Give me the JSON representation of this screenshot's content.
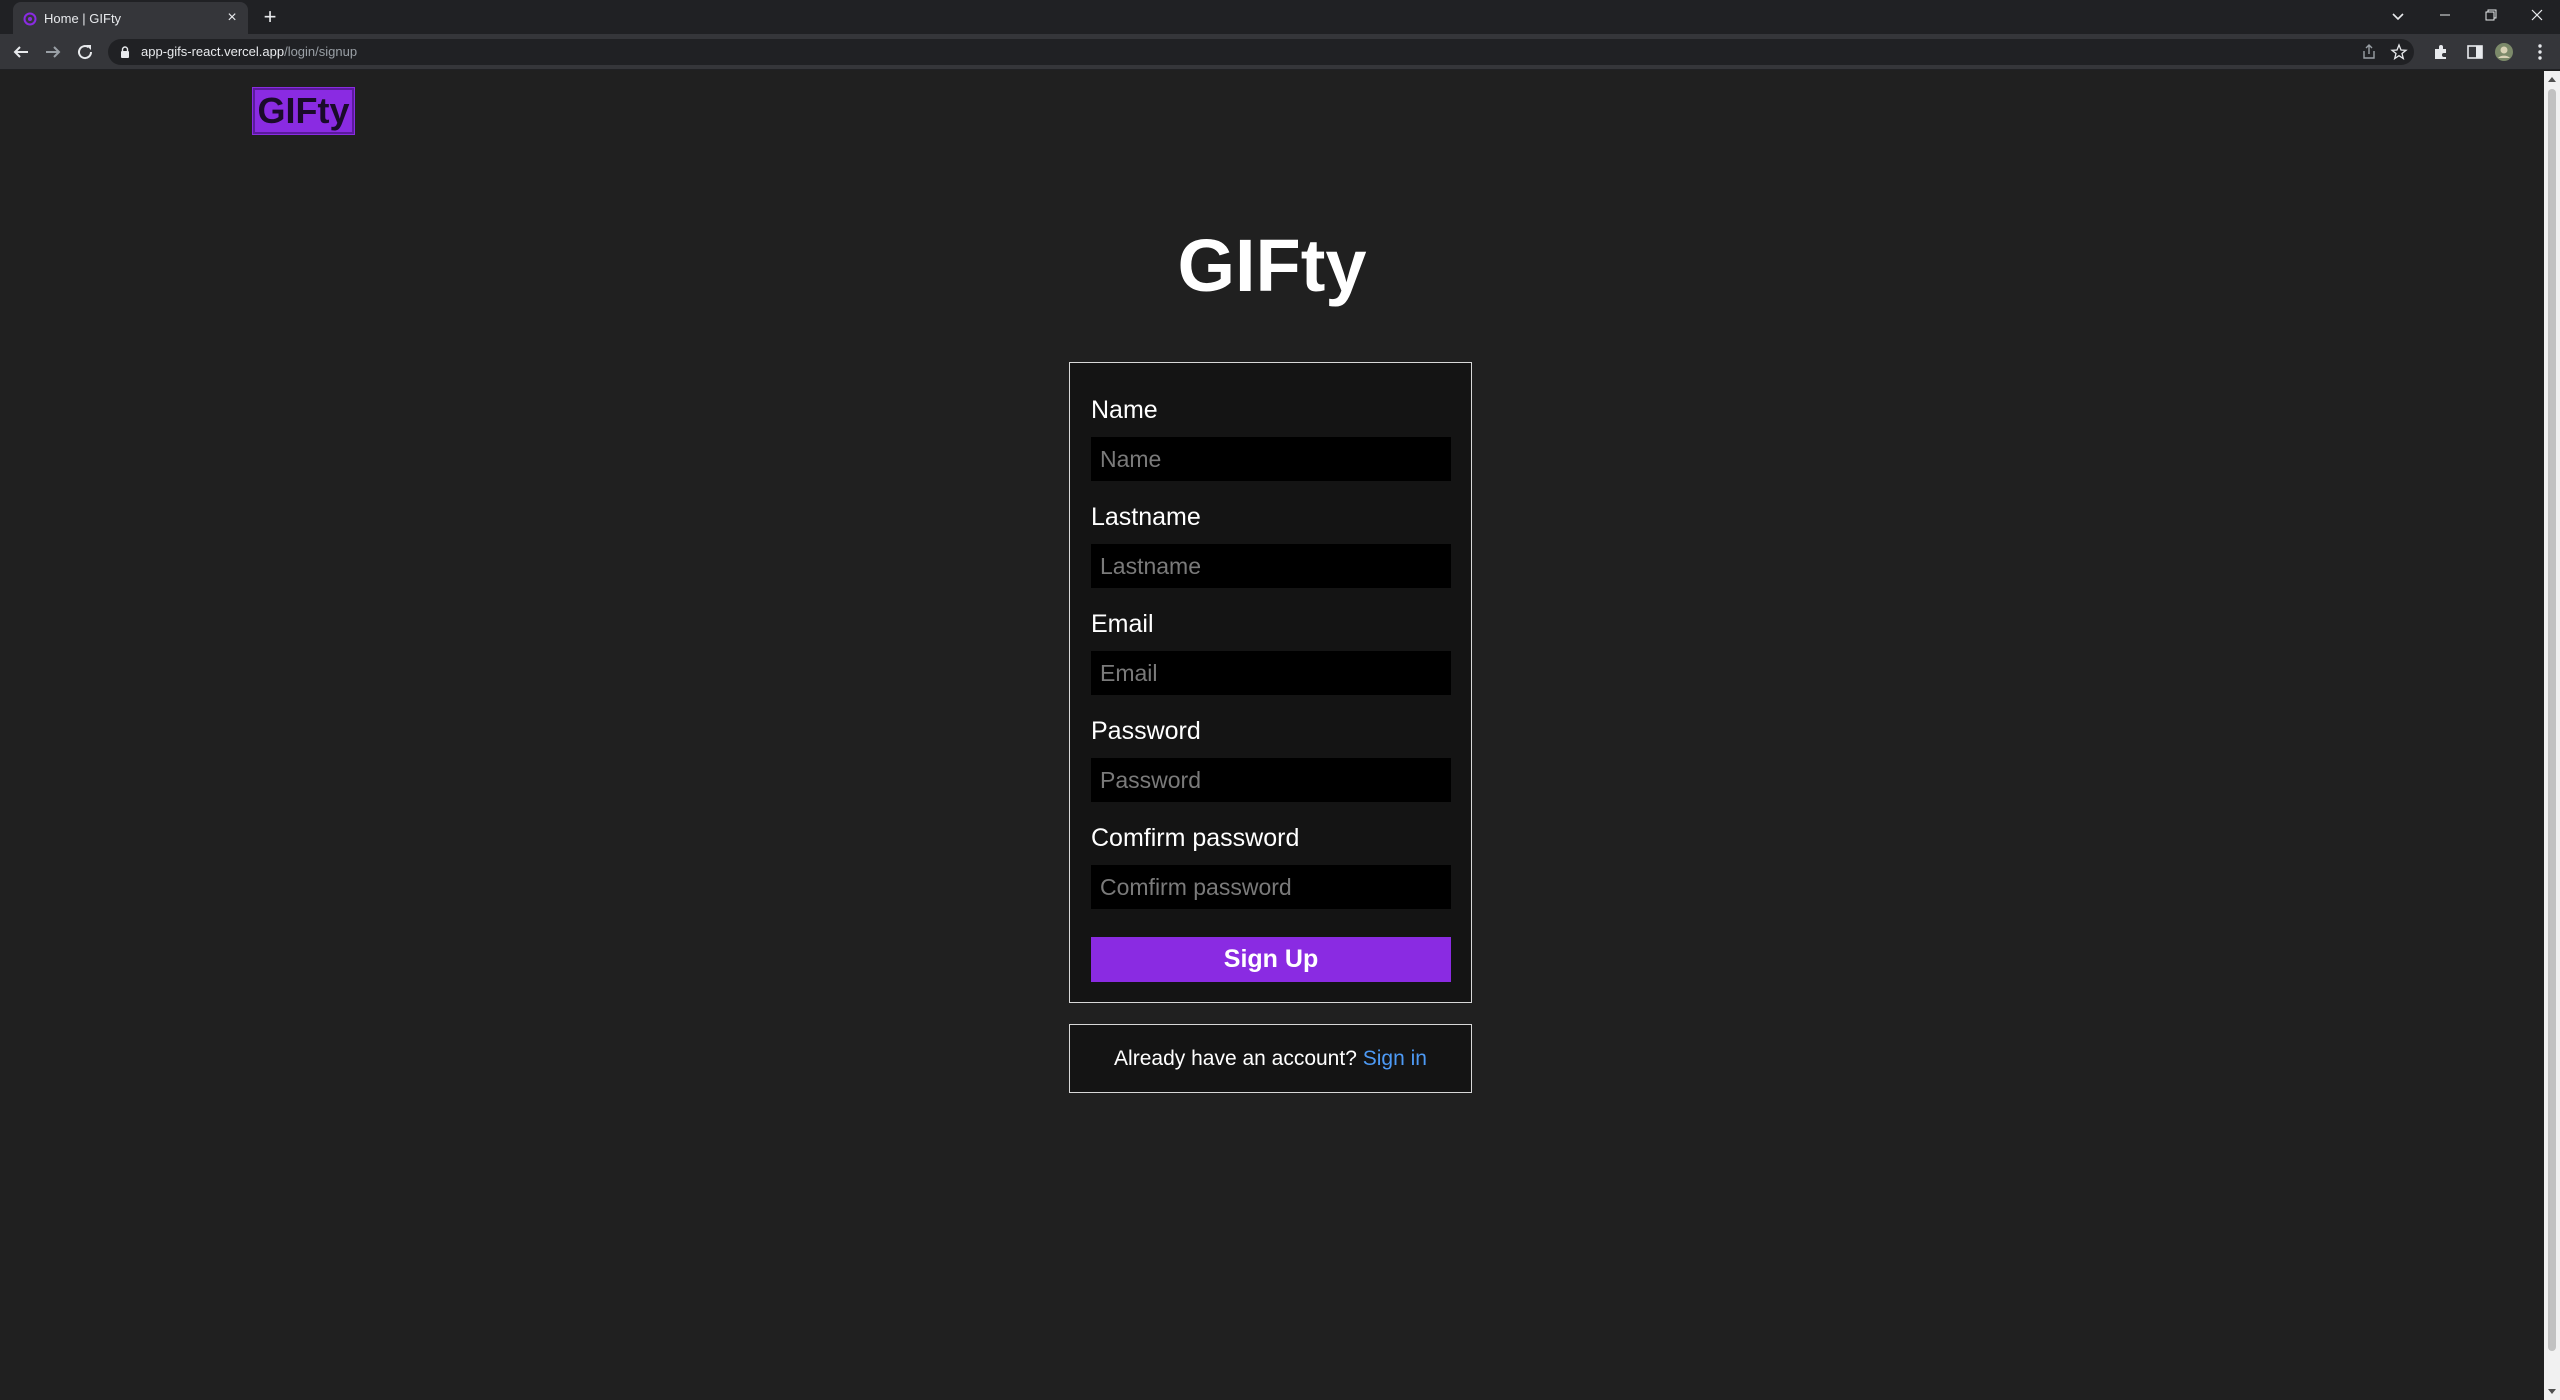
{
  "browser": {
    "tab_title": "Home | GIFty",
    "new_tab_symbol": "+",
    "url_host": "app-gifs-react.vercel.app",
    "url_path": "/login/signup"
  },
  "header": {
    "logo_text": "GIFty"
  },
  "main": {
    "title": "GIFty"
  },
  "form": {
    "fields": [
      {
        "label": "Name",
        "placeholder": "Name"
      },
      {
        "label": "Lastname",
        "placeholder": "Lastname"
      },
      {
        "label": "Email",
        "placeholder": "Email"
      },
      {
        "label": "Password",
        "placeholder": "Password"
      },
      {
        "label": "Comfirm password",
        "placeholder": "Comfirm password"
      }
    ],
    "submit_label": "Sign Up"
  },
  "signin": {
    "prompt": "Already have an account?",
    "link_label": "Sign in"
  },
  "colors": {
    "accent": "#8a2be2",
    "link": "#4d9af5",
    "background": "#202020",
    "card": "#141414"
  }
}
